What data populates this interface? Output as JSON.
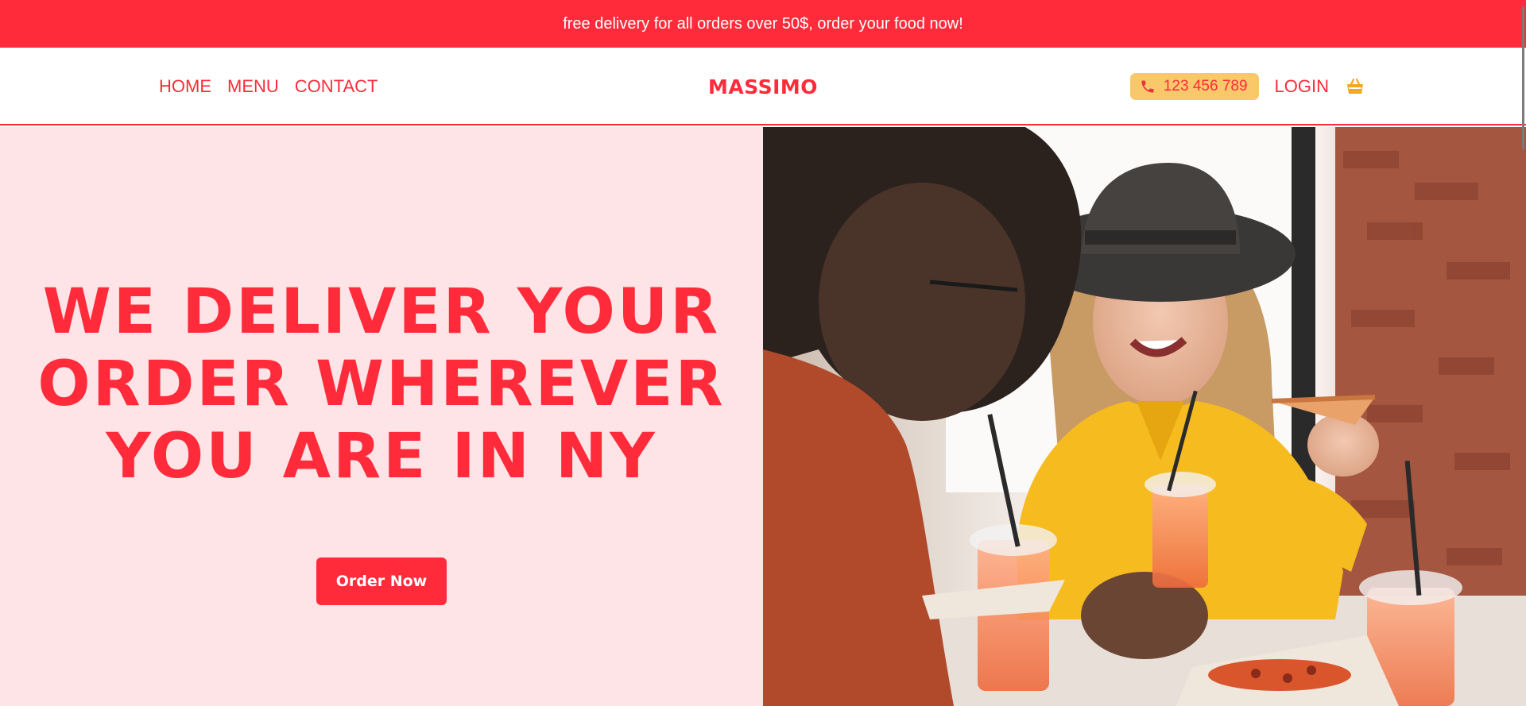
{
  "promo": {
    "text": "free delivery for all orders over 50$, order your food now!"
  },
  "nav": {
    "items": [
      {
        "label": "HOME"
      },
      {
        "label": "MENU"
      },
      {
        "label": "CONTACT"
      }
    ]
  },
  "brand": {
    "name": "MASSIMO"
  },
  "header_tools": {
    "phone": "123 456 789",
    "login": "LOGIN",
    "phone_icon": "phone-icon",
    "cart_icon": "basket-icon"
  },
  "hero": {
    "title_lines": [
      "WE DELIVER YOUR",
      "ORDER WHEREVER",
      "YOU ARE IN NY"
    ],
    "cta": "Order Now",
    "image": "photo of two people eating pizza with drinks at a restaurant table"
  },
  "colors": {
    "accent": "#ff2b3a",
    "hero_bg": "#ffe4e7",
    "phone_pill": "#f9c86b",
    "basket": "#f5a623"
  }
}
